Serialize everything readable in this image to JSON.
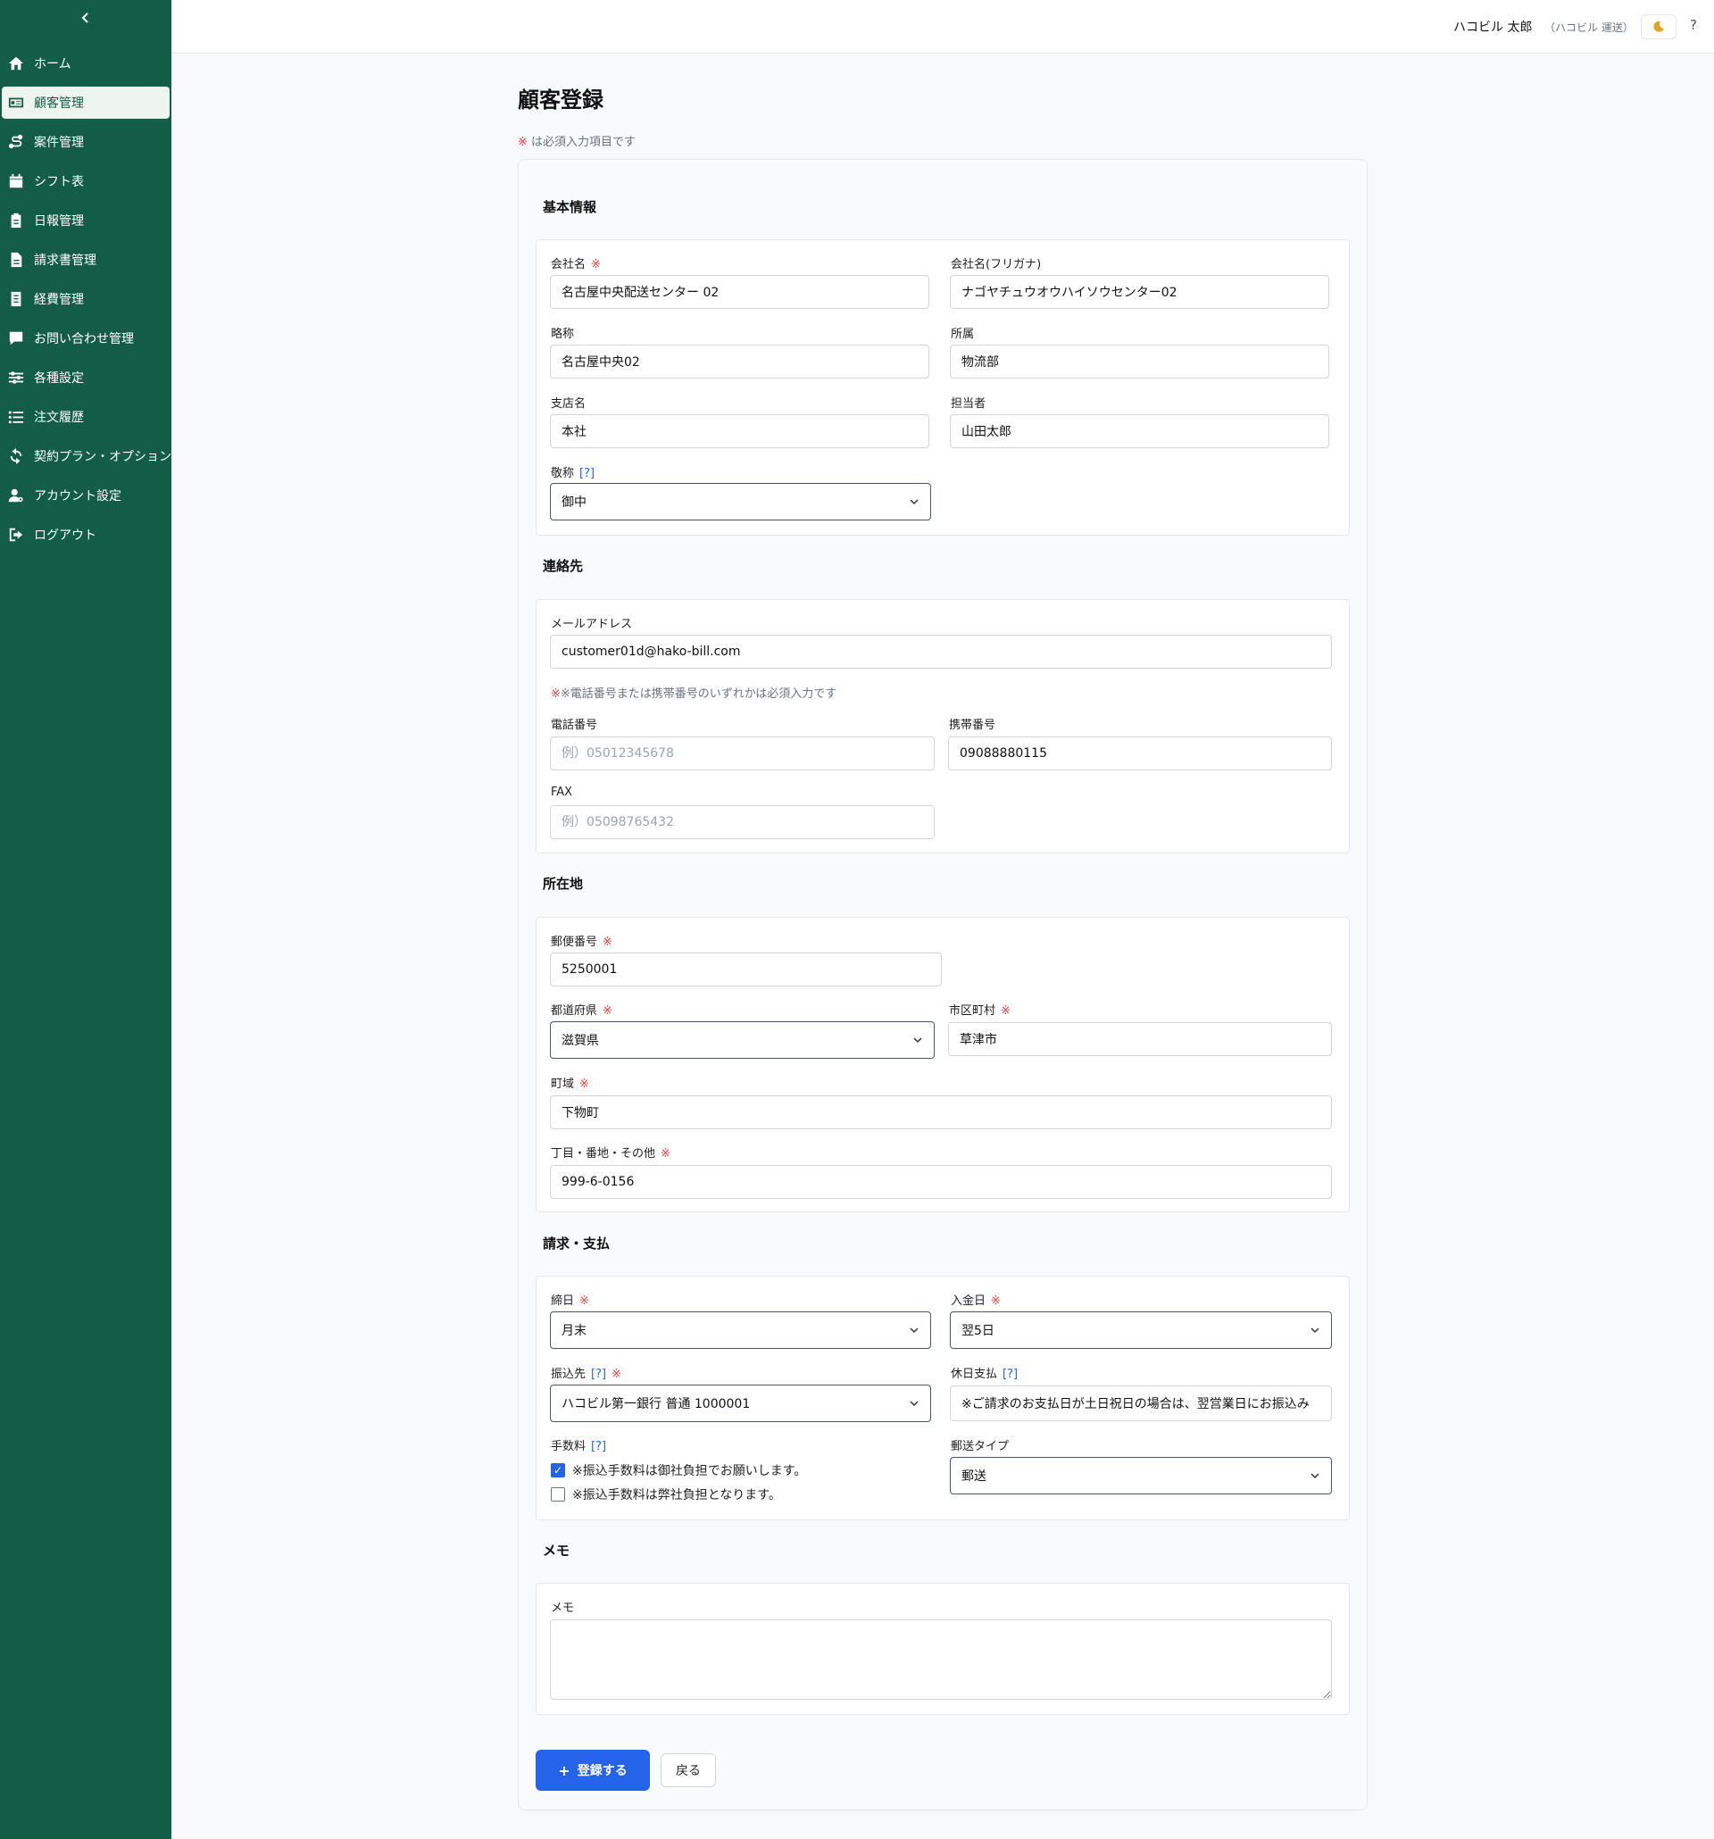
{
  "sidebar": {
    "collapse_icon": "chevron-left-icon",
    "items": [
      {
        "label": "ホーム",
        "icon": "home-icon"
      },
      {
        "label": "顧客管理",
        "icon": "id-card-icon",
        "active": true
      },
      {
        "label": "案件管理",
        "icon": "route-icon"
      },
      {
        "label": "シフト表",
        "icon": "calendar-icon"
      },
      {
        "label": "日報管理",
        "icon": "clipboard-icon"
      },
      {
        "label": "請求書管理",
        "icon": "file-icon"
      },
      {
        "label": "経費管理",
        "icon": "receipt-icon"
      },
      {
        "label": "お問い合わせ管理",
        "icon": "comment-icon"
      },
      {
        "label": "各種設定",
        "icon": "sliders-icon"
      },
      {
        "label": "注文履歴",
        "icon": "list-icon"
      },
      {
        "label": "契約プラン・オプション",
        "icon": "refresh-icon"
      },
      {
        "label": "アカウント設定",
        "icon": "user-gear-icon"
      },
      {
        "label": "ログアウト",
        "icon": "logout-icon"
      }
    ]
  },
  "header": {
    "user_name": "ハコビル 太郎",
    "user_org": "（ハコビル 運送）",
    "theme_icon": "moon-icon",
    "help": "?"
  },
  "page": {
    "title": "顧客登録",
    "required_mark": "※",
    "required_note": " は必須入力項目です"
  },
  "sections": {
    "basic": "基本情報",
    "contact": "連絡先",
    "address": "所在地",
    "billing": "請求・支払",
    "memo": "メモ"
  },
  "fields": {
    "company_name": {
      "label": "会社名",
      "value": "名古屋中央配送センター 02"
    },
    "company_kana": {
      "label": "会社名(フリガナ)",
      "value": "ナゴヤチュウオウハイソウセンター02"
    },
    "short_name": {
      "label": "略称",
      "value": "名古屋中央02"
    },
    "department": {
      "label": "所属",
      "value": "物流部"
    },
    "branch": {
      "label": "支店名",
      "value": "本社"
    },
    "person": {
      "label": "担当者",
      "value": "山田太郎"
    },
    "honorific": {
      "label": "敬称",
      "help": "[?]",
      "value": "御中"
    },
    "email": {
      "label": "メールアドレス",
      "value": "customer01d@hako-bill.com"
    },
    "phone_note": "※電話番号または携帯番号のいずれかは必須入力です",
    "phone": {
      "label": "電話番号",
      "placeholder": "例）05012345678",
      "value": ""
    },
    "mobile": {
      "label": "携帯番号",
      "value": "09088880115"
    },
    "fax": {
      "label": "FAX",
      "placeholder": "例）05098765432",
      "value": ""
    },
    "postal": {
      "label": "郵便番号",
      "value": "5250001"
    },
    "prefecture": {
      "label": "都道府県",
      "value": "滋賀県"
    },
    "city": {
      "label": "市区町村",
      "value": "草津市"
    },
    "town": {
      "label": "町域",
      "value": "下物町"
    },
    "street": {
      "label": "丁目・番地・その他",
      "value": "999-6-0156"
    },
    "closing_day": {
      "label": "締日",
      "value": "月末"
    },
    "payment_day": {
      "label": "入金日",
      "value": "翌5日"
    },
    "bank": {
      "label": "振込先",
      "help": "[?]",
      "value": "ハコビル第一銀行 普通 1000001"
    },
    "holiday_payment": {
      "label": "休日支払",
      "help": "[?]",
      "value": "※ご請求のお支払日が土日祝日の場合は、翌営業日にお振込み"
    },
    "fee": {
      "label": "手数料",
      "help": "[?]",
      "options": [
        {
          "label": "※振込手数料は御社負担でお願いします。",
          "checked": true
        },
        {
          "label": "※振込手数料は弊社負担となります。",
          "checked": false
        }
      ]
    },
    "mail_type": {
      "label": "郵送タイプ",
      "value": "郵送"
    },
    "memo": {
      "label": "メモ",
      "value": ""
    }
  },
  "buttons": {
    "submit_icon": "plus-icon",
    "submit": "登録する",
    "back": "戻る"
  },
  "colors": {
    "sidebar_bg": "#135c45",
    "primary": "#2563eb",
    "required": "#e53e3e"
  }
}
